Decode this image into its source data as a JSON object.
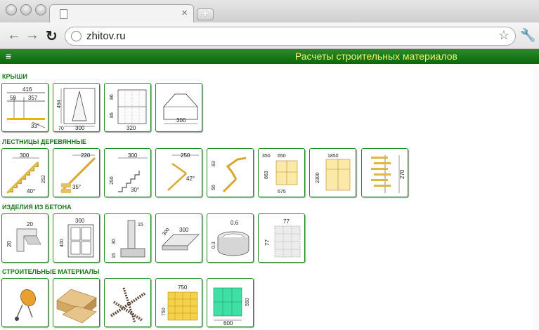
{
  "browser": {
    "url": "zhitov.ru",
    "tab_close_glyph": "×",
    "newtab_glyph": "+"
  },
  "site": {
    "title": "Расчеты строительных материалов",
    "menu_glyph": "≡"
  },
  "sections": [
    {
      "title": "КРЫШИ"
    },
    {
      "title": "ЛЕСТНИЦЫ ДЕРЕВЯННЫЕ"
    },
    {
      "title": "ИЗДЕЛИЯ ИЗ БЕТОНА"
    },
    {
      "title": "СТРОИТЕЛЬНЫЕ МАТЕРИАЛЫ"
    }
  ],
  "roof_tiles": {
    "t1": {
      "top": "416",
      "a": "59",
      "b": "357",
      "angle": "33°"
    },
    "t2": {
      "h": "494",
      "w": "300",
      "side": "70"
    },
    "t3": {
      "a": "86",
      "b": "86",
      "w": "320"
    },
    "t4": {
      "w": "300"
    }
  },
  "stair_tiles": {
    "s1": {
      "w": "300",
      "h": "252",
      "angle": "40°"
    },
    "s2": {
      "w": "220",
      "angle": "35°"
    },
    "s3": {
      "w": "300",
      "h": "250",
      "angle": "30°"
    },
    "s4": {
      "w": "250",
      "angle": "42°"
    },
    "s5": {
      "a": "83",
      "b": "56"
    },
    "s6": {
      "a": "350",
      "b": "650",
      "h": "863",
      "w": "675"
    },
    "s7": {
      "w": "1850",
      "h": "2300"
    },
    "s8": {
      "h": "270"
    }
  },
  "concrete_tiles": {
    "c1": {
      "w": "20",
      "h": "20"
    },
    "c2": {
      "w": "300",
      "h": "400"
    },
    "c3": {
      "a": "15",
      "b": "30",
      "c": "15"
    },
    "c4": {
      "w": "300",
      "d": "300"
    },
    "c5": {
      "a": "0.6",
      "b": "0.3"
    },
    "c6": {
      "a": "77",
      "b": "77"
    }
  },
  "material_tiles": {
    "m4": {
      "w": "750",
      "h": "750"
    },
    "m5": {
      "h": "550",
      "w": "600"
    }
  }
}
